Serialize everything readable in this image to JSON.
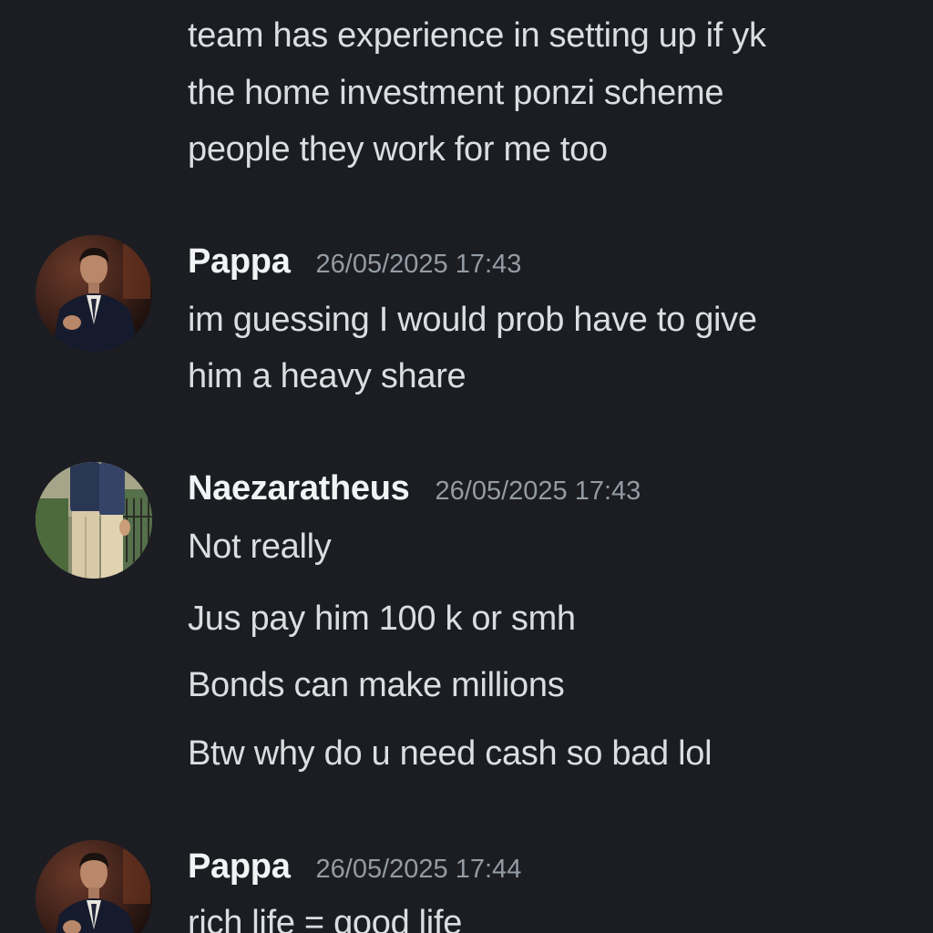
{
  "messages": [
    {
      "continuation": true,
      "lines": [
        "team has experience in setting up if yk",
        "the home investment ponzi scheme",
        "people they work for me too"
      ]
    },
    {
      "username": "Pappa",
      "timestamp": "26/05/2025 17:43",
      "lines": [
        "im guessing I would prob have to give",
        "him a heavy share"
      ]
    },
    {
      "username": "Naezaratheus",
      "timestamp": "26/05/2025 17:43",
      "lines": [
        "Not really",
        "Jus pay him 100 k or smh",
        "Bonds can make millions",
        "Btw why do u need cash so bad lol"
      ]
    },
    {
      "username": "Pappa",
      "timestamp": "26/05/2025 17:44",
      "lines": [
        "rich life = good life"
      ]
    }
  ]
}
